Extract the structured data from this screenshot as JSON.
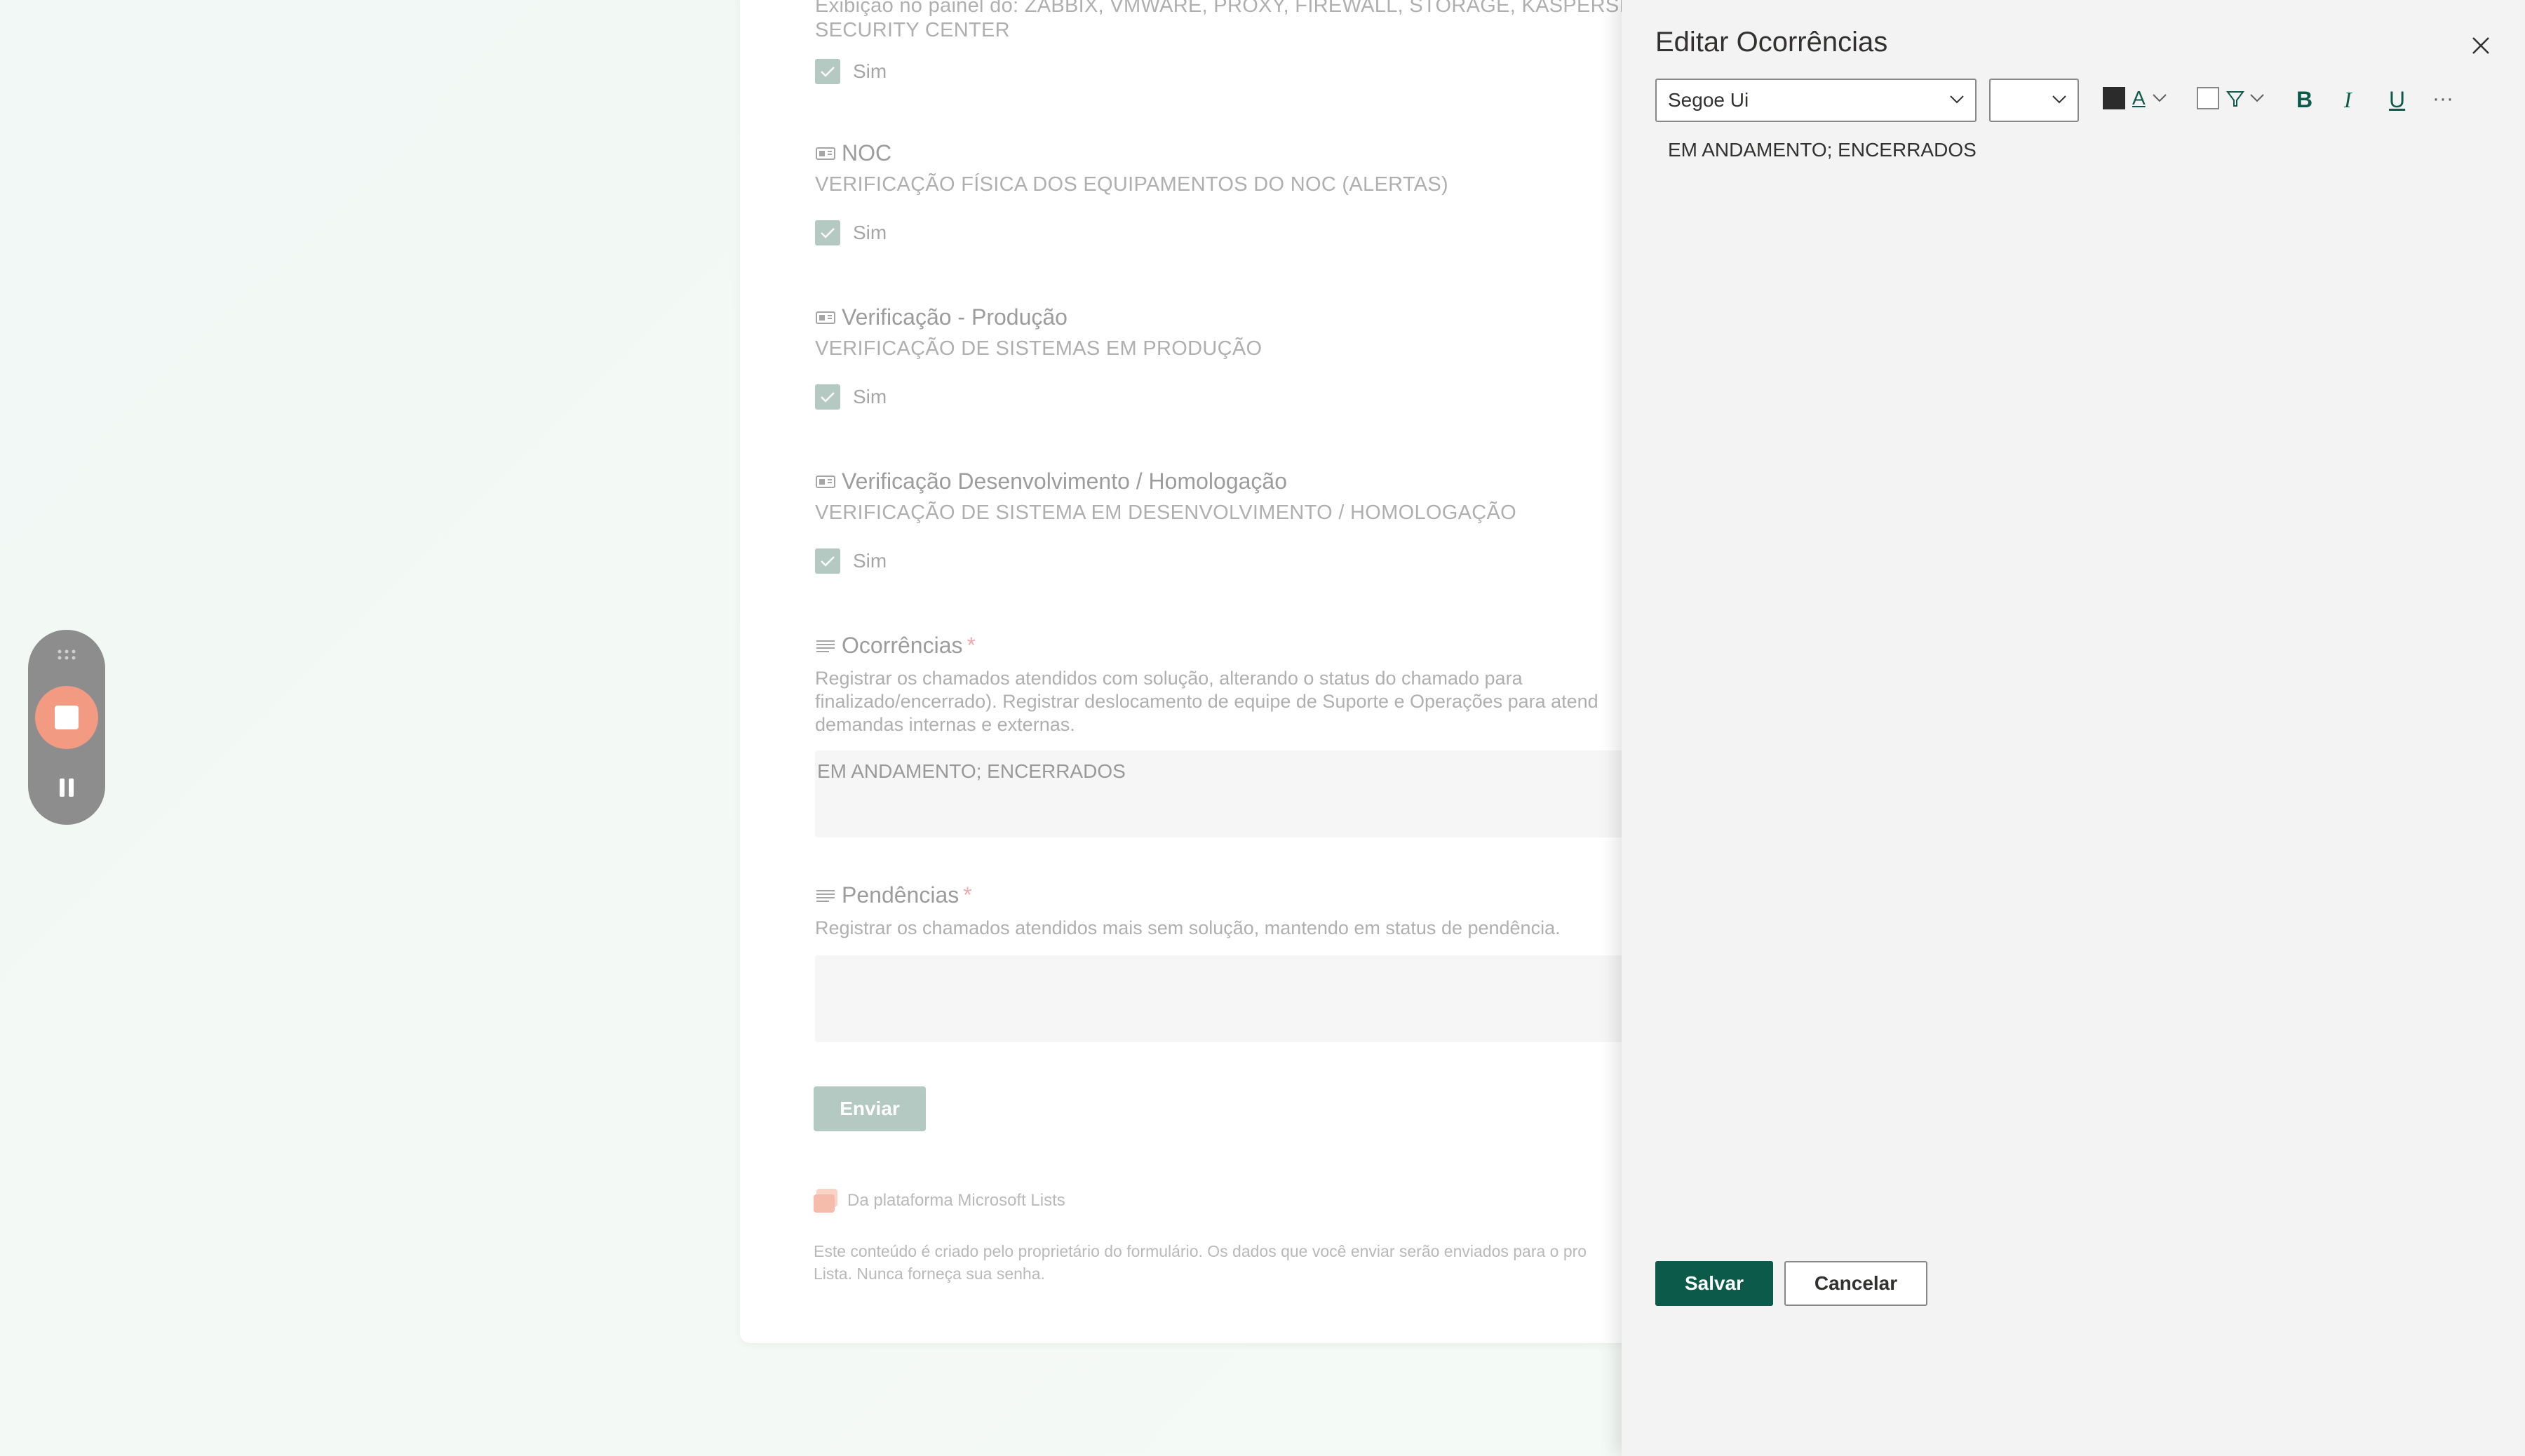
{
  "form": {
    "top_fragment_line1": "Exibição no painel do: ZABBIX, VMWARE, PROXY, FIREWALL, STORAGE, KASPERSKY",
    "top_fragment_line2": "SECURITY CENTER",
    "check_label": "Sim",
    "questions": [
      {
        "title": "NOC",
        "subtitle": "VERIFICAÇÃO FÍSICA DOS EQUIPAMENTOS DO NOC (ALERTAS)",
        "answer": "Sim"
      },
      {
        "title": "Verificação - Produção",
        "subtitle": "VERIFICAÇÃO DE SISTEMAS EM PRODUÇÃO",
        "answer": "Sim"
      },
      {
        "title": "Verificação Desenvolvimento / Homologação",
        "subtitle": "VERIFICAÇÃO DE SISTEMA EM DESENVOLVIMENTO / HOMOLOGAÇÃO",
        "answer": "Sim"
      }
    ],
    "ocorrencias": {
      "title": "Ocorrências",
      "required_mark": "*",
      "desc_line1": "Registrar os chamados atendidos com solução, alterando o status do chamado para",
      "desc_line2": "finalizado/encerrado). Registrar deslocamento de equipe de Suporte e Operações para atend",
      "desc_line3": "demandas internas e externas.",
      "value": "EM ANDAMENTO; ENCERRADOS"
    },
    "pendencias": {
      "title": "Pendências",
      "required_mark": "*",
      "desc": "Registrar os chamados atendidos mais sem solução, mantendo em status de pendência.",
      "value": ""
    },
    "submit_label": "Enviar",
    "footer_brand": "Da plataforma Microsoft Lists",
    "footer_note_line1": "Este conteúdo é criado pelo proprietário do formulário. Os dados que você enviar serão enviados para o pro",
    "footer_note_line2": "Lista. Nunca forneça sua senha."
  },
  "panel": {
    "title": "Editar Ocorrências",
    "font_family_value": "Segoe Ui",
    "font_size_value": "",
    "editor_text": "EM ANDAMENTO; ENCERRADOS",
    "save_label": "Salvar",
    "cancel_label": "Cancelar",
    "text_color_letter": "A",
    "bold_letter": "B",
    "italic_letter": "I",
    "underline_letter": "U",
    "more_label": "···"
  },
  "colors": {
    "accent_green": "#0b5a4a",
    "form_accent": "#81a599",
    "recorder_stop": "#f29a82",
    "required": "#e57373"
  }
}
